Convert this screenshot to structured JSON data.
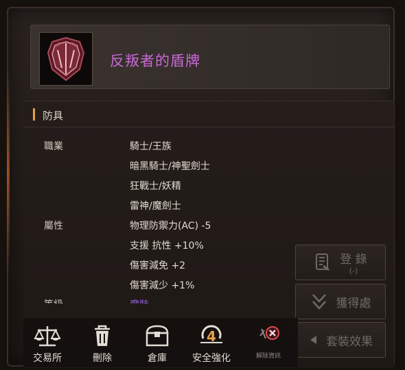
{
  "item": {
    "name": "反叛者的盾牌",
    "name_color": "#c86ad6"
  },
  "category": "防具",
  "details": {
    "class_label": "職業",
    "classes": [
      "騎士/王族",
      "暗黑騎士/神聖劍士",
      "狂戰士/妖精",
      "雷神/魔劍士"
    ],
    "attr_label": "屬性",
    "attributes": [
      "物理防禦力(AC) -5",
      "支援 抗性 +10%",
      "傷害減免 +2",
      "傷害減少 +1%"
    ],
    "next_label": "等級",
    "next_value": "魔裝"
  },
  "side_buttons": {
    "register": "登 錄",
    "register_sub": "(-)",
    "obtain": "獲得處",
    "set_effect": "套裝效果"
  },
  "bottom_bar": {
    "trade": "交易所",
    "delete": "刪除",
    "storage": "倉庫",
    "safe_enhance": "安全強化",
    "enhance_count": "4",
    "disable": "解除資訊"
  },
  "colors": {
    "accent": "#e8a04a",
    "disabled_text": "#6f6863"
  }
}
